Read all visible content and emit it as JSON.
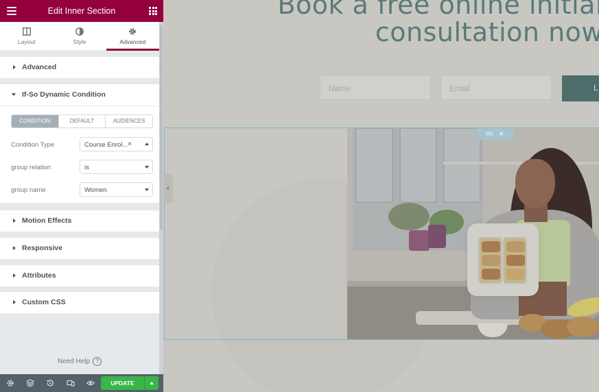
{
  "panel": {
    "title": "Edit Inner Section",
    "tabs": [
      {
        "label": "Layout",
        "icon": "layout-icon"
      },
      {
        "label": "Style",
        "icon": "style-icon"
      },
      {
        "label": "Advanced",
        "icon": "gear-icon"
      }
    ],
    "active_tab": "Advanced",
    "sections": {
      "advanced": "Advanced",
      "ifso": "If-So Dynamic Condition",
      "motion": "Motion Effects",
      "responsive": "Responsive",
      "attributes": "Attributes",
      "custom_css": "Custom CSS"
    },
    "ifso": {
      "segments": [
        "Condition",
        "Default",
        "Audiences"
      ],
      "selected_segment": "Condition",
      "condition_type_label": "Condition Type",
      "condition_type_value": "Course Enrol...",
      "group_relation_label": "group relation",
      "group_relation_value": "is",
      "group_name_label": "group name",
      "group_name_value": "Women"
    },
    "need_help": "Need Help",
    "update_label": "UPDATE",
    "accent_color": "#93003c",
    "update_color": "#39b54a"
  },
  "canvas": {
    "headline_line1": "Book a free online initial",
    "headline_line2": "consultation now",
    "name_placeholder": "Name",
    "email_placeholder": "Email",
    "submit_label": "L",
    "heading_color": "#587b78"
  }
}
